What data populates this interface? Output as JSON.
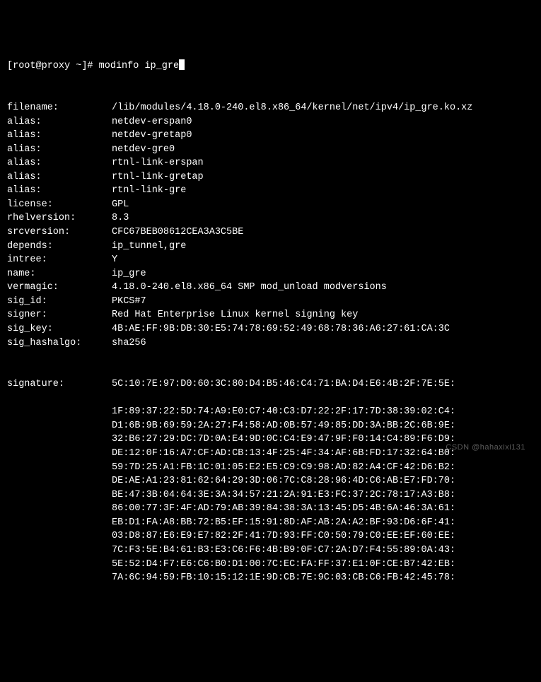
{
  "prompt": {
    "user_host": "[root@proxy ~]#",
    "command": "modinfo ip_gre"
  },
  "fields": [
    {
      "label": "filename:",
      "value": "/lib/modules/4.18.0-240.el8.x86_64/kernel/net/ipv4/ip_gre.ko.xz"
    },
    {
      "label": "alias:",
      "value": "netdev-erspan0"
    },
    {
      "label": "alias:",
      "value": "netdev-gretap0"
    },
    {
      "label": "alias:",
      "value": "netdev-gre0"
    },
    {
      "label": "alias:",
      "value": "rtnl-link-erspan"
    },
    {
      "label": "alias:",
      "value": "rtnl-link-gretap"
    },
    {
      "label": "alias:",
      "value": "rtnl-link-gre"
    },
    {
      "label": "license:",
      "value": "GPL"
    },
    {
      "label": "rhelversion:",
      "value": "8.3"
    },
    {
      "label": "srcversion:",
      "value": "CFC67BEB08612CEA3A3C5BE"
    },
    {
      "label": "depends:",
      "value": "ip_tunnel,gre"
    },
    {
      "label": "intree:",
      "value": "Y"
    },
    {
      "label": "name:",
      "value": "ip_gre"
    },
    {
      "label": "vermagic:",
      "value": "4.18.0-240.el8.x86_64 SMP mod_unload modversions"
    },
    {
      "label": "sig_id:",
      "value": "PKCS#7"
    },
    {
      "label": "signer:",
      "value": "Red Hat Enterprise Linux kernel signing key"
    },
    {
      "label": "sig_key:",
      "value": "4B:AE:FF:9B:DB:30:E5:74:78:69:52:49:68:78:36:A6:27:61:CA:3C"
    },
    {
      "label": "sig_hashalgo:",
      "value": "sha256"
    }
  ],
  "signature": {
    "label": "signature:",
    "lines": [
      "5C:10:7E:97:D0:60:3C:80:D4:B5:46:C4:71:BA:D4:E6:4B:2F:7E:5E:",
      "1F:89:37:22:5D:74:A9:E0:C7:40:C3:D7:22:2F:17:7D:38:39:02:C4:",
      "D1:6B:9B:69:59:2A:27:F4:58:AD:0B:57:49:85:DD:3A:BB:2C:6B:9E:",
      "32:B6:27:29:DC:7D:0A:E4:9D:0C:C4:E9:47:9F:F0:14:C4:89:F6:D9:",
      "DE:12:0F:16:A7:CF:AD:CB:13:4F:25:4F:34:AF:6B:FD:17:32:64:B0:",
      "59:7D:25:A1:FB:1C:01:05:E2:E5:C9:C9:98:AD:82:A4:CF:42:D6:B2:",
      "DE:AE:A1:23:81:62:64:29:3D:06:7C:C8:28:96:4D:C6:AB:E7:FD:70:",
      "BE:47:3B:04:64:3E:3A:34:57:21:2A:91:E3:FC:37:2C:78:17:A3:B8:",
      "86:00:77:3F:4F:AD:79:AB:39:84:38:3A:13:45:D5:4B:6A:46:3A:61:",
      "EB:D1:FA:A8:BB:72:B5:EF:15:91:8D:AF:AB:2A:A2:BF:93:D6:6F:41:",
      "03:D8:87:E6:E9:E7:82:2F:41:7D:93:FF:C0:50:79:C0:EE:EF:60:EE:",
      "7C:F3:5E:B4:61:B3:E3:C6:F6:4B:B9:0F:C7:2A:D7:F4:55:89:0A:43:",
      "5E:52:D4:F7:E6:C6:B0:D1:00:7C:EC:FA:FF:37:E1:0F:CE:B7:42:EB:",
      "7A:6C:94:59:FB:10:15:12:1E:9D:CB:7E:9C:03:CB:C6:FB:42:45:78:"
    ]
  },
  "watermark": "CSDN @hahaxixi131"
}
